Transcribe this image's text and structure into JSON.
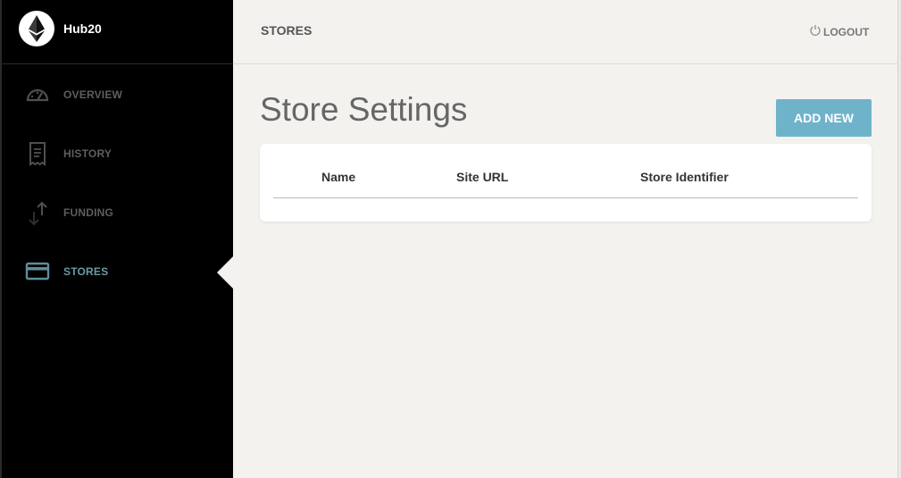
{
  "brand": {
    "name": "Hub20"
  },
  "sidebar": {
    "items": [
      {
        "label": "OVERVIEW",
        "icon": "speedometer-icon"
      },
      {
        "label": "HISTORY",
        "icon": "receipt-icon"
      },
      {
        "label": "FUNDING",
        "icon": "transfer-arrows-icon"
      },
      {
        "label": "STORES",
        "icon": "credit-card-icon",
        "active": true
      }
    ]
  },
  "header": {
    "title": "STORES",
    "logout_label": "LOGOUT"
  },
  "main": {
    "title": "Store Settings",
    "add_button_label": "ADD NEW",
    "table": {
      "columns": [
        "Name",
        "Site URL",
        "Store Identifier"
      ],
      "rows": []
    }
  },
  "colors": {
    "sidebar_bg": "#000000",
    "content_bg": "#f3f2ef",
    "accent": "#6fb3cb",
    "active_nav": "#6c9aa6"
  }
}
